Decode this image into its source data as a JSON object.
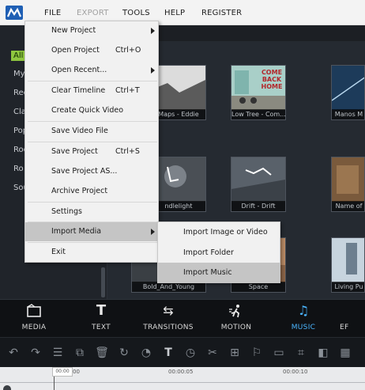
{
  "menubar": {
    "items": [
      "FILE",
      "EXPORT",
      "TOOLS",
      "HELP",
      "REGISTER"
    ],
    "disabled_item": "EXPORT"
  },
  "sidebar": {
    "categories": [
      "All",
      "My",
      "Rec",
      "Cla",
      "Pop",
      "Roc",
      "Ro",
      "Sou"
    ],
    "active": "All"
  },
  "library": {
    "items": [
      {
        "caption": "Maps - Eddie"
      },
      {
        "caption": "Low Tree - Com..."
      },
      {
        "caption": "Manos M"
      },
      {
        "caption": "ndlelight"
      },
      {
        "caption": "Drift - Drift"
      },
      {
        "caption": "Name of"
      },
      {
        "caption": "Bold_And_Young"
      },
      {
        "caption": "Space"
      },
      {
        "caption": "Living Pu"
      }
    ],
    "poster_text": [
      "COME",
      "BACK",
      "HOME"
    ]
  },
  "file_menu": {
    "items": [
      {
        "label": "New Project",
        "shortcut": "",
        "submenu": true
      },
      {
        "label": "Open Project",
        "shortcut": "Ctrl+O",
        "submenu": false
      },
      {
        "label": "Open Recent...",
        "shortcut": "",
        "submenu": true
      },
      {
        "label": "Clear Timeline",
        "shortcut": "Ctrl+T",
        "submenu": false
      },
      {
        "label": "Create Quick Video",
        "shortcut": "",
        "submenu": false
      },
      {
        "label": "Save Video File",
        "shortcut": "",
        "submenu": false
      },
      {
        "label": "Save Project",
        "shortcut": "Ctrl+S",
        "submenu": false
      },
      {
        "label": "Save Project AS...",
        "shortcut": "",
        "submenu": false
      },
      {
        "label": "Archive Project",
        "shortcut": "",
        "submenu": false
      },
      {
        "label": "Settings",
        "shortcut": "",
        "submenu": false
      },
      {
        "label": "Import Media",
        "shortcut": "",
        "submenu": true
      },
      {
        "label": "Exit",
        "shortcut": "",
        "submenu": false
      }
    ],
    "highlighted": "Import Media"
  },
  "import_submenu": {
    "items": [
      "Import Image or Video",
      "Import Folder",
      "Import Music"
    ],
    "highlighted": "Import Music"
  },
  "toolbar": {
    "tabs": [
      {
        "label": "MEDIA",
        "icon": "media-icon"
      },
      {
        "label": "TEXT",
        "icon": "text-icon"
      },
      {
        "label": "TRANSITIONS",
        "icon": "transitions-icon"
      },
      {
        "label": "MOTION",
        "icon": "motion-icon"
      },
      {
        "label": "MUSIC",
        "icon": "music-icon"
      },
      {
        "label": "EF",
        "icon": "effects-icon"
      }
    ],
    "active": "MUSIC"
  },
  "timeline": {
    "playhead_time": "00:00",
    "labels": [
      "00",
      "00:00:05",
      "00:00:10"
    ]
  },
  "colors": {
    "accent_green": "#8ec63f",
    "accent_blue": "#4bb6ff",
    "menu_highlight": "#c5c5c5"
  }
}
